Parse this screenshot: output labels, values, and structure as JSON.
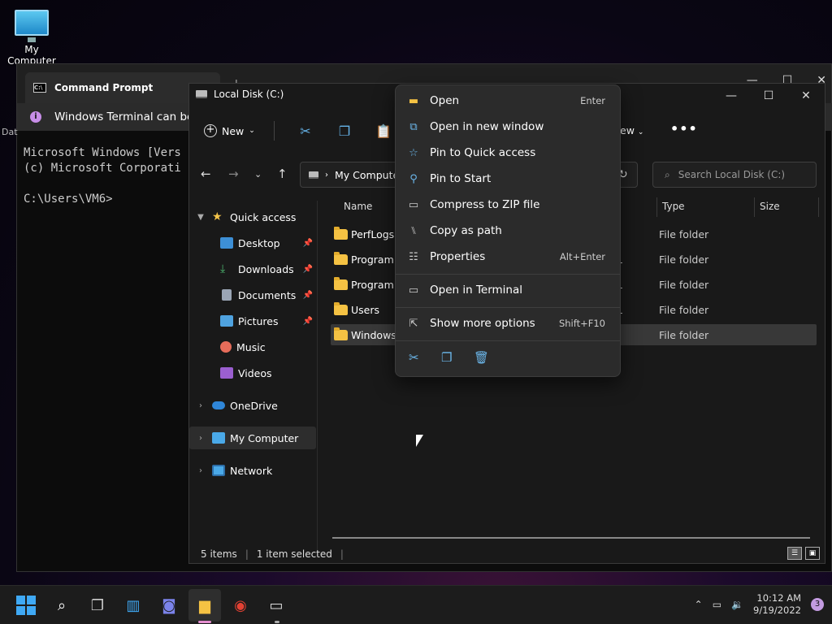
{
  "desktop": {
    "icon_label": "My Computer",
    "partial_label": "Dat"
  },
  "terminal": {
    "tab_title": "Command Prompt",
    "notice": "Windows Terminal can be s",
    "lines": [
      "Microsoft Windows [Vers",
      "(c) Microsoft Corporati",
      "",
      "C:\\Users\\VM6>"
    ]
  },
  "explorer": {
    "title": "Local Disk (C:)",
    "toolbar": {
      "new_label": "New",
      "view_label": "ew",
      "more": "•••"
    },
    "address": "My Compute",
    "search_placeholder": "Search Local Disk (C:)",
    "sidebar": [
      {
        "label": "Quick access",
        "icon": "star-icon",
        "color": "#f3c44a",
        "expanded": true
      },
      {
        "label": "Desktop",
        "icon": "desktop-icon",
        "color": "#3d8fd6",
        "pinned": true
      },
      {
        "label": "Downloads",
        "icon": "download-icon",
        "color": "#4cb56f",
        "pinned": true
      },
      {
        "label": "Documents",
        "icon": "document-icon",
        "color": "#9aa5b5",
        "pinned": true
      },
      {
        "label": "Pictures",
        "icon": "picture-icon",
        "color": "#4fa3e0",
        "pinned": true
      },
      {
        "label": "Music",
        "icon": "music-icon",
        "color": "#e66c5a"
      },
      {
        "label": "Videos",
        "icon": "video-icon",
        "color": "#9b5fd0"
      },
      {
        "label": "OneDrive",
        "icon": "cloud-icon",
        "color": "#2f86d8"
      },
      {
        "label": "My Computer",
        "icon": "computer-icon",
        "color": "#4aa9e8",
        "selected": true
      },
      {
        "label": "Network",
        "icon": "network-icon",
        "color": "#4aa9e8"
      }
    ],
    "columns": {
      "name": "Name",
      "type": "Type",
      "size": "Size"
    },
    "rows": [
      {
        "name": "PerfLogs",
        "mod": "",
        "type": "File folder"
      },
      {
        "name": "Program F",
        "mod": "1",
        "type": "File folder"
      },
      {
        "name": "Program F",
        "mod": "1",
        "type": "File folder"
      },
      {
        "name": "Users",
        "mod": "1",
        "type": "File folder"
      },
      {
        "name": "Windows",
        "mod": "",
        "type": "File folder",
        "selected": true
      }
    ],
    "status": {
      "items": "5 items",
      "selected": "1 item selected"
    }
  },
  "context_menu": {
    "items": [
      {
        "label": "Open",
        "key": "Enter",
        "icon": "folder-open-icon"
      },
      {
        "label": "Open in new window",
        "key": "",
        "icon": "new-window-icon"
      },
      {
        "label": "Pin to Quick access",
        "key": "",
        "icon": "star-outline-icon"
      },
      {
        "label": "Pin to Start",
        "key": "",
        "icon": "pin-icon"
      },
      {
        "label": "Compress to ZIP file",
        "key": "",
        "icon": "zip-icon"
      },
      {
        "label": "Copy as path",
        "key": "",
        "icon": "copy-path-icon"
      },
      {
        "label": "Properties",
        "key": "Alt+Enter",
        "icon": "properties-icon"
      },
      {
        "label": "Open in Terminal",
        "key": "",
        "icon": "terminal-icon"
      },
      {
        "label": "Show more options",
        "key": "Shift+F10",
        "icon": "more-options-icon"
      }
    ]
  },
  "taskbar": {
    "time": "10:12 AM",
    "date": "9/19/2022",
    "notifications": "3"
  }
}
